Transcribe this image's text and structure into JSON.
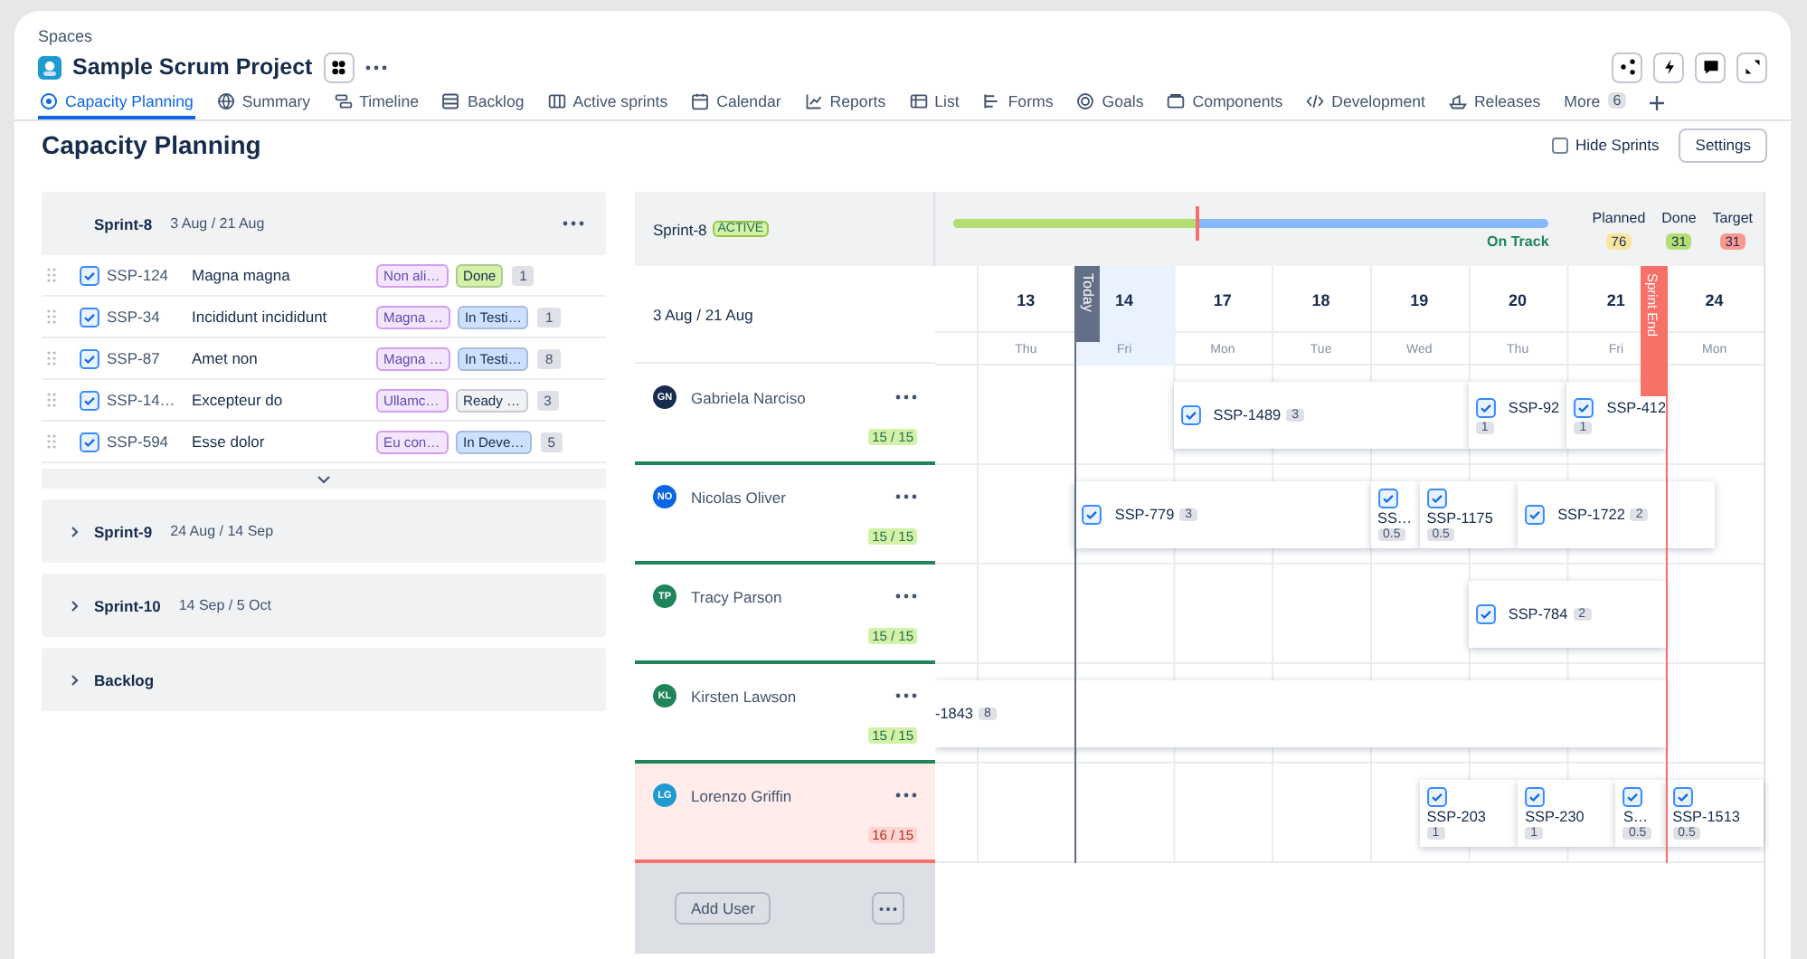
{
  "breadcrumb": "Spaces",
  "project": {
    "title": "Sample Scrum Project"
  },
  "tabs": [
    {
      "label": "Capacity Planning",
      "selected": true
    },
    {
      "label": "Summary",
      "selected": false
    },
    {
      "label": "Timeline",
      "selected": false
    },
    {
      "label": "Backlog",
      "selected": false
    },
    {
      "label": "Active sprints",
      "selected": false
    },
    {
      "label": "Calendar",
      "selected": false
    },
    {
      "label": "Reports",
      "selected": false
    },
    {
      "label": "List",
      "selected": false
    },
    {
      "label": "Forms",
      "selected": false
    },
    {
      "label": "Goals",
      "selected": false
    },
    {
      "label": "Components",
      "selected": false
    },
    {
      "label": "Development",
      "selected": false
    },
    {
      "label": "Releases",
      "selected": false
    }
  ],
  "more_tab": {
    "label": "More",
    "count": "6"
  },
  "page": {
    "title": "Capacity Planning",
    "hide_sprints": {
      "label": "Hide Sprints",
      "checked": false
    },
    "settings_button": "Settings"
  },
  "sprints": [
    {
      "name": "Sprint-8",
      "dates": "3 Aug / 21 Aug",
      "expanded": true,
      "issues": [
        {
          "key": "SSP-124",
          "summary": "Magna magna",
          "label": "Non ali…",
          "status": "Done",
          "color": "#d3f1a7",
          "estimate": "1"
        },
        {
          "key": "SSP-34",
          "summary": "Incididunt incididunt",
          "label": "Magna …",
          "status": "In Testi…",
          "color": "#cce0ff",
          "estimate": "1"
        },
        {
          "key": "SSP-87",
          "summary": "Amet non",
          "label": "Magna …",
          "status": "In Testi…",
          "color": "#cce0ff",
          "estimate": "8"
        },
        {
          "key": "SSP-14…",
          "summary": "Excepteur do",
          "label": "Ullamc…",
          "status": "Ready …",
          "color": "#f1f2f4",
          "estimate": "3"
        },
        {
          "key": "SSP-594",
          "summary": "Esse dolor",
          "label": "Eu con…",
          "status": "In Deve…",
          "color": "#cce0ff",
          "estimate": "5"
        }
      ]
    },
    {
      "name": "Sprint-9",
      "dates": "24 Aug / 14 Sep",
      "expanded": false
    },
    {
      "name": "Sprint-10",
      "dates": "14 Sep / 5 Oct",
      "expanded": false
    },
    {
      "name": "Backlog",
      "expanded": false
    }
  ],
  "timeline": {
    "sprint": "Sprint-8",
    "badge": "ACTIVE",
    "level": 0.41,
    "track_status": "On Track",
    "stats": [
      {
        "label": "Planned",
        "value": "76",
        "color": "#f8e6a0"
      },
      {
        "label": "Done",
        "value": "31",
        "color": "#b3df72"
      },
      {
        "label": "Target",
        "value": "31",
        "color": "#fd9891"
      }
    ],
    "range": "3 Aug / 21 Aug",
    "today_label": "Today",
    "sprint_end_label": "Sprint End",
    "days": [
      {
        "day": "13",
        "weekday": "Thu",
        "selected": false
      },
      {
        "day": "14",
        "weekday": "Fri",
        "selected": true
      },
      {
        "day": "17",
        "weekday": "Mon",
        "selected": false
      },
      {
        "day": "18",
        "weekday": "Tue",
        "selected": false
      },
      {
        "day": "19",
        "weekday": "Wed",
        "selected": false
      },
      {
        "day": "20",
        "weekday": "Thu",
        "selected": false
      },
      {
        "day": "21",
        "weekday": "Fri",
        "selected": false
      },
      {
        "day": "24",
        "weekday": "Mon",
        "selected": false
      }
    ],
    "users": [
      {
        "initials": "GN",
        "name": "Gabriela Narciso",
        "color": "#172b4d",
        "capacity": "15 / 15",
        "over_capacity": false,
        "tasks": [
          {
            "key": "SSP-1489",
            "estimate": "3",
            "kind": "wide"
          },
          {
            "key": "SSP-92",
            "estimate": "1",
            "kind": "compact"
          },
          {
            "key": "SSP-412",
            "estimate": "1",
            "kind": "compact"
          }
        ]
      },
      {
        "initials": "NO",
        "name": "Nicolas Oliver",
        "color": "#0c66e4",
        "capacity": "15 / 15",
        "over_capacity": false,
        "tasks": [
          {
            "key": "SSP-779",
            "estimate": "3",
            "kind": "wide"
          },
          {
            "key": "SS…",
            "estimate": "0.5",
            "kind": "tall"
          },
          {
            "key": "SSP-1175",
            "estimate": "0.5",
            "kind": "tall"
          },
          {
            "key": "SSP-1722",
            "estimate": "2",
            "kind": "wide"
          }
        ]
      },
      {
        "initials": "TP",
        "name": "Tracy Parson",
        "color": "#1f845a",
        "capacity": "15 / 15",
        "over_capacity": false,
        "tasks": [
          {
            "key": "SSP-784",
            "estimate": "2",
            "kind": "wide"
          }
        ]
      },
      {
        "initials": "KL",
        "name": "Kirsten Lawson",
        "color": "#1f845a",
        "capacity": "15 / 15",
        "over_capacity": false,
        "tasks": [
          {
            "key": "-1843",
            "estimate": "8",
            "kind": "clipped"
          }
        ]
      },
      {
        "initials": "LG",
        "name": "Lorenzo Griffin",
        "color": "#1d9bd1",
        "capacity": "16 / 15",
        "over_capacity": true,
        "tasks": [
          {
            "key": "SSP-203",
            "estimate": "1",
            "kind": "tall"
          },
          {
            "key": "SSP-230",
            "estimate": "1",
            "kind": "tall"
          },
          {
            "key": "S…",
            "estimate": "0.5",
            "kind": "tall"
          },
          {
            "key": "SSP-1513",
            "estimate": "0.5",
            "kind": "tall"
          }
        ]
      }
    ],
    "add_user_button": "Add User"
  }
}
